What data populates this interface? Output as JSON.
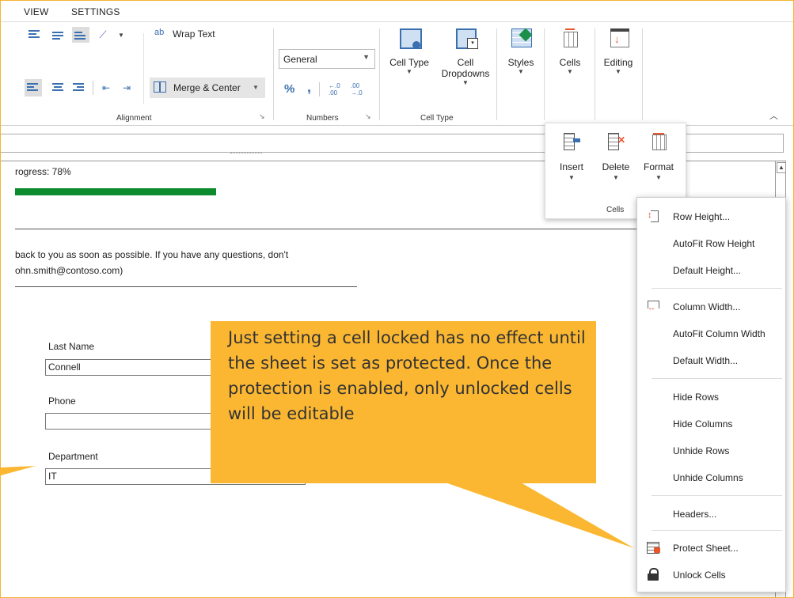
{
  "menu_tabs": [
    "VIEW",
    "SETTINGS"
  ],
  "alignment": {
    "wrap_text": "Wrap Text",
    "wrap_icon_text": "ab",
    "merge_center": "Merge & Center",
    "group_label": "Alignment"
  },
  "numbers": {
    "format_value": "General",
    "percent": "%",
    "comma": ",",
    "increase_decimal": "←.0 .00",
    "decrease_decimal": ".00 →.0",
    "group_label": "Numbers"
  },
  "cell_type": {
    "cell_type_label": "Cell Type",
    "dropdowns_label_1": "Cell",
    "dropdowns_label_2": "Dropdowns",
    "group_label": "Cell Type"
  },
  "styles_label": "Styles",
  "cells_label": "Cells",
  "editing_label": "Editing",
  "cells_popup": {
    "insert": "Insert",
    "delete": "Delete",
    "format": "Format",
    "group_label": "Cells"
  },
  "format_menu": {
    "row_height": "Row Height...",
    "autofit_row_height": "AutoFit Row Height",
    "default_height": "Default Height...",
    "column_width": "Column Width...",
    "autofit_column_width": "AutoFit Column Width",
    "default_width": "Default Width...",
    "hide_rows": "Hide Rows",
    "hide_columns": "Hide Columns",
    "unhide_rows": "Unhide Rows",
    "unhide_columns": "Unhide Columns",
    "headers": "Headers...",
    "protect_sheet": "Protect Sheet...",
    "unlock_cells": "Unlock Cells"
  },
  "sheet": {
    "progress_text": "rogress: 78%",
    "progress_value": 0.78,
    "message_line1": "back to you as soon as possible. If you have any questions, don't",
    "message_line2": "ohn.smith@contoso.com)",
    "last_name_label": "Last Name",
    "last_name_value": "Connell",
    "phone_label": "Phone",
    "phone_value": "",
    "department_label": "Department",
    "department_value": "IT"
  },
  "callout_text": "Just setting a cell locked has no effect until the sheet is set as protected. Once the protection is enabled, only unlocked cells will be editable",
  "colors": {
    "callout": "#fbb731",
    "progress": "#0b8a2e",
    "accent_blue": "#3a6fb0",
    "accent_orange": "#e8572b"
  }
}
